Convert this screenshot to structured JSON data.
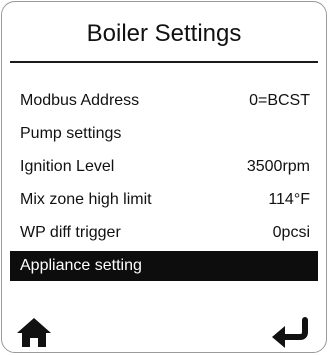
{
  "screen": {
    "title": "Boiler Settings"
  },
  "menu": {
    "items": [
      {
        "label": "Modbus Address",
        "value": "0=BCST",
        "selected": false
      },
      {
        "label": "Pump settings",
        "value": "",
        "selected": false
      },
      {
        "label": "Ignition Level",
        "value": "3500rpm",
        "selected": false
      },
      {
        "label": "Mix zone high limit",
        "value": "114°F",
        "selected": false
      },
      {
        "label": "WP diff trigger",
        "value": "0pcsi",
        "selected": false
      },
      {
        "label": "Appliance setting",
        "value": "",
        "selected": true
      }
    ]
  },
  "nav": {
    "home_icon": "home-icon",
    "back_icon": "return-arrow-icon"
  },
  "colors": {
    "selected_background": "#0d0d0d",
    "selected_text": "#ffffff",
    "text": "#111111",
    "divider": "#1a1a1a",
    "frame_border": "#9a9a9a"
  }
}
